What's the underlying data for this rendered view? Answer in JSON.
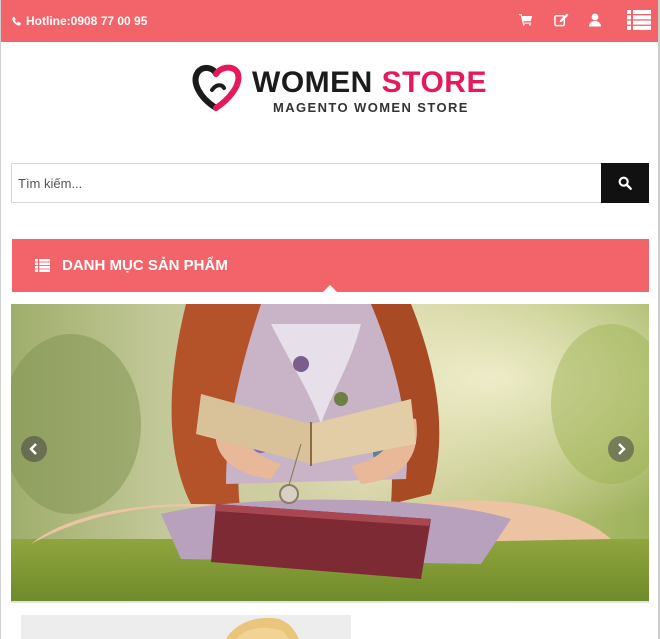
{
  "topbar": {
    "hotline": "Hotline:0908 77 00 95",
    "icons": [
      "phone-icon",
      "cart-icon",
      "edit-icon",
      "user-icon",
      "menu-list-icon"
    ],
    "background": "#f2646a"
  },
  "logo": {
    "title_part1": "WOMEN",
    "title_part2": "STORE",
    "subtitle": "MAGENTO WOMEN STORE",
    "accent": "#e8195a"
  },
  "search": {
    "placeholder": "Tìm kiếm...",
    "value": "",
    "button_icon": "search-icon"
  },
  "category": {
    "label": "DANH MỤC SẢN PHẨM",
    "icon": "list-icon"
  },
  "slider": {
    "prev_icon": "chevron-left-icon",
    "next_icon": "chevron-right-icon"
  }
}
